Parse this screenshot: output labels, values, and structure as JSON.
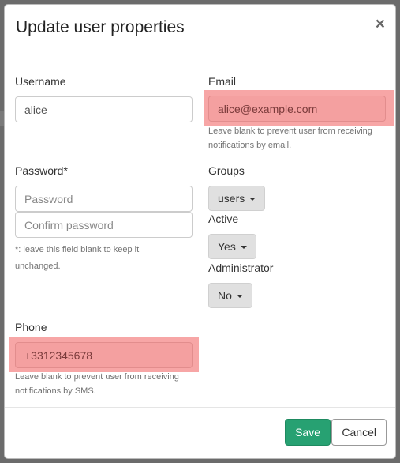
{
  "modal": {
    "title": "Update user properties",
    "close_glyph": "×"
  },
  "form": {
    "username": {
      "label": "Username",
      "value": "alice"
    },
    "email": {
      "label": "Email",
      "value": "alice@example.com",
      "help": "Leave blank to prevent user from receiving notifications by email."
    },
    "password": {
      "label": "Password*",
      "placeholder": "Password",
      "confirm_placeholder": "Confirm password",
      "help": "*: leave this field blank to keep it unchanged."
    },
    "groups": {
      "label": "Groups",
      "value": "users"
    },
    "active": {
      "label": "Active",
      "value": "Yes"
    },
    "administrator": {
      "label": "Administrator",
      "value": "No"
    },
    "phone": {
      "label": "Phone",
      "value": "+3312345678",
      "help": "Leave blank to prevent user from receiving notifications by SMS."
    }
  },
  "footer": {
    "save_label": "Save",
    "cancel_label": "Cancel"
  },
  "colors": {
    "backdrop": "#6b6b6b",
    "highlight": "#f7a6a6",
    "save_button": "#27a172"
  }
}
